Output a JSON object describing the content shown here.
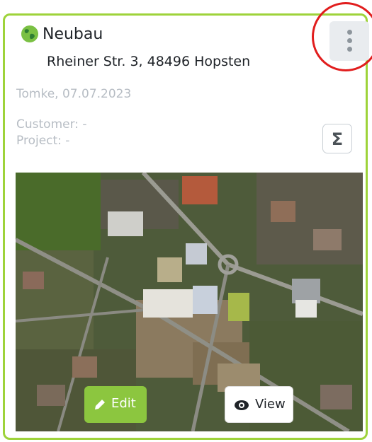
{
  "card": {
    "title": "Neubau",
    "address": "Rheiner Str. 3, 48496 Hopsten",
    "author_date": "Tomke, 07.07.2023",
    "customer": "Customer: -",
    "project": "Project: -",
    "sum_symbol": "Σ",
    "edit_label": "Edit",
    "view_label": "View"
  },
  "icons": {
    "globe": "globe-icon",
    "menu": "kebab-menu-icon",
    "sum": "sigma-icon",
    "edit": "pencil-icon",
    "view": "eye-icon"
  },
  "colors": {
    "accent_green": "#8cc63f",
    "card_border": "#9ed33a",
    "highlight_ring": "#e11d1d",
    "muted_text": "#b7bdc4"
  }
}
